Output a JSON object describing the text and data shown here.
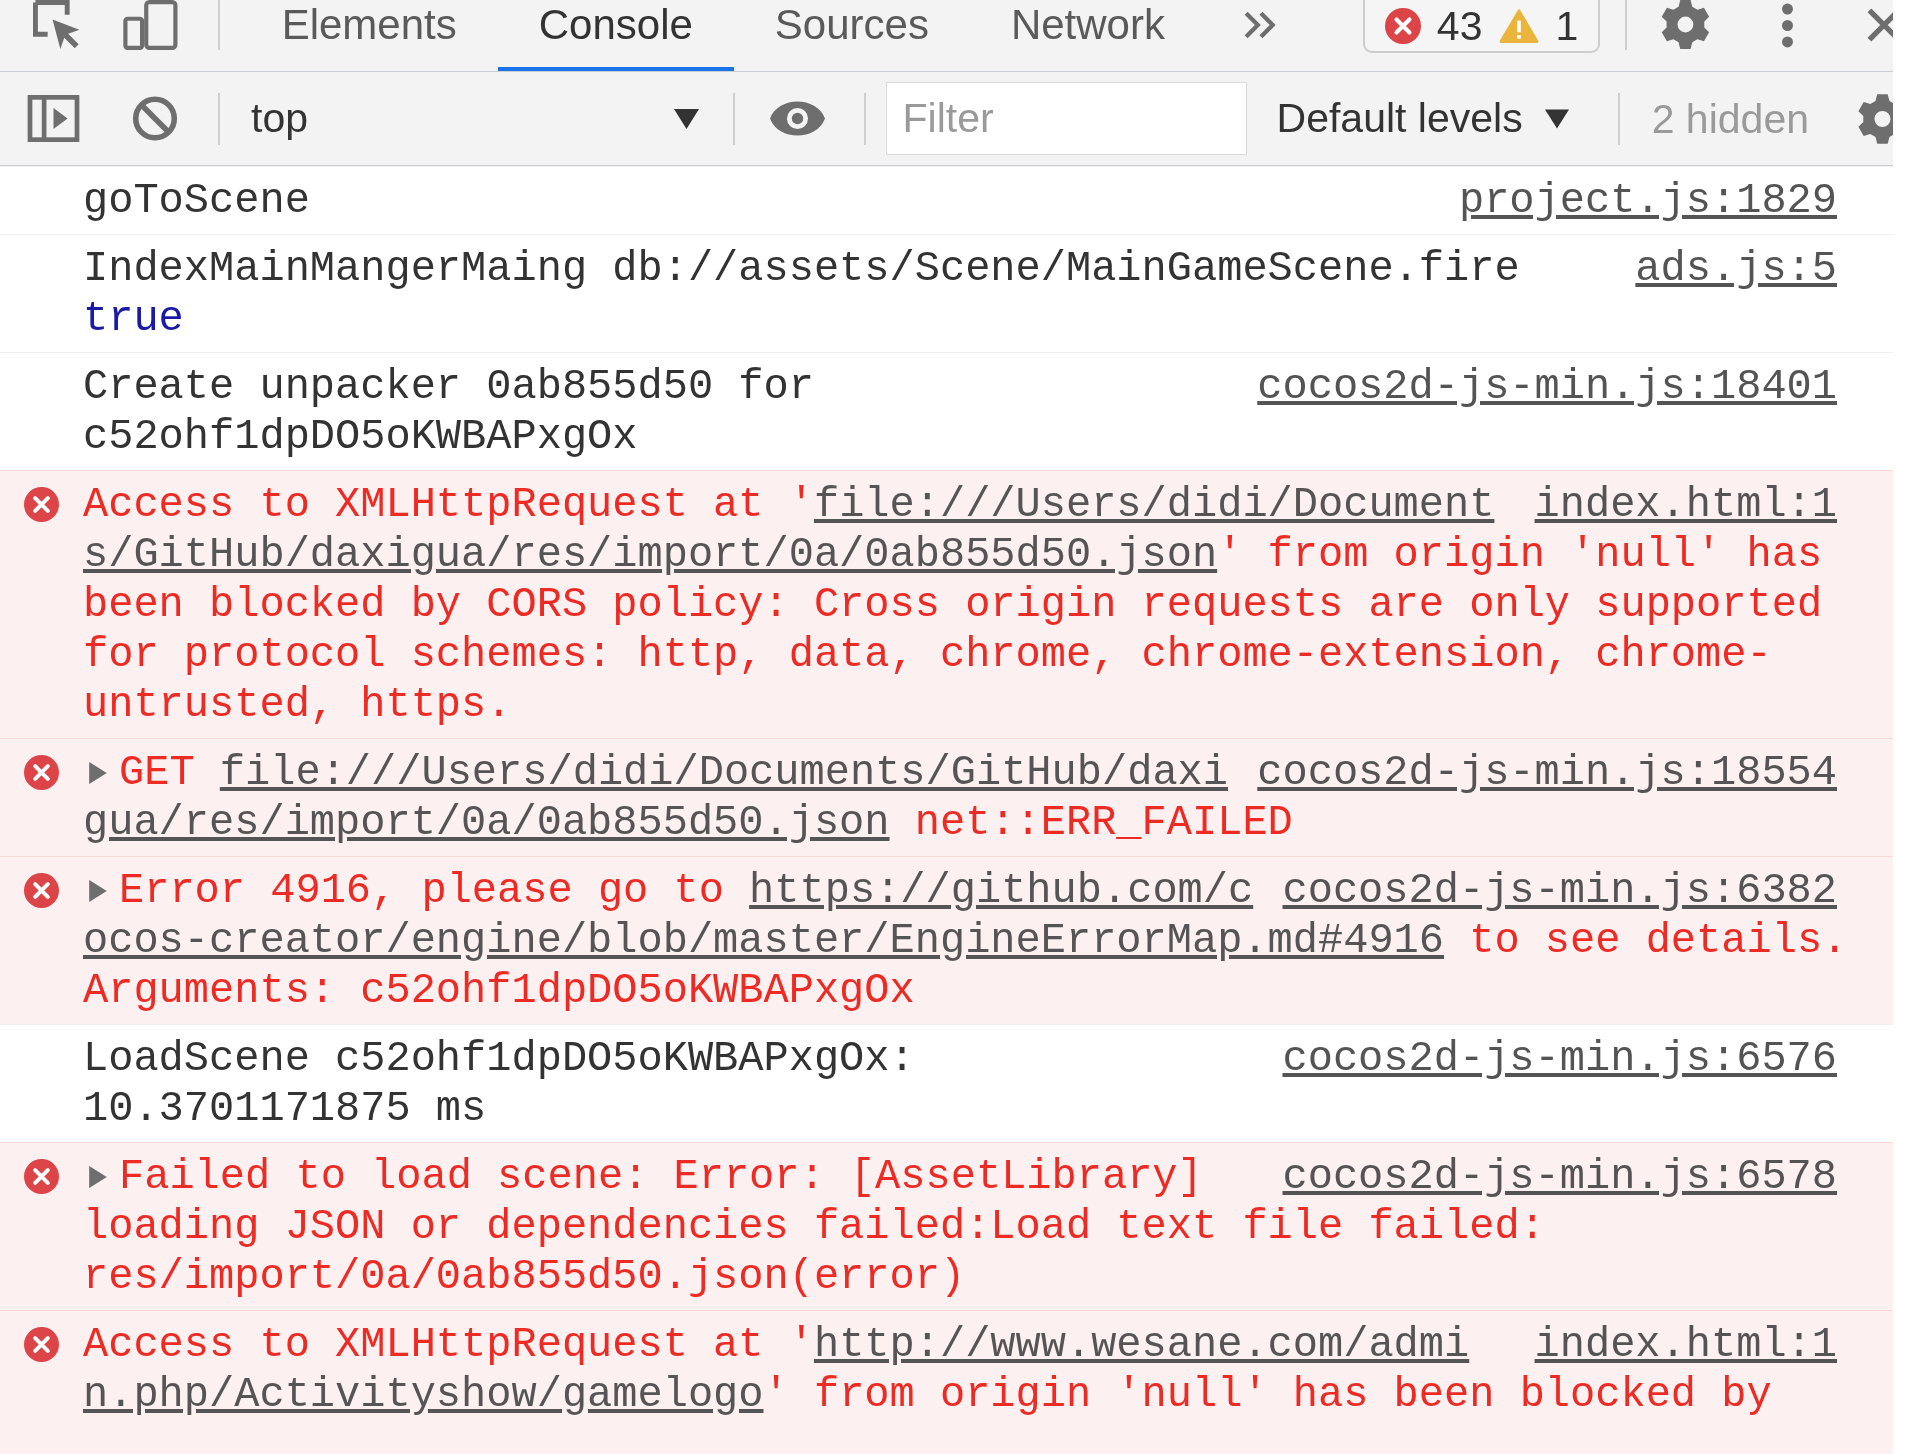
{
  "tabs": [
    {
      "label": "Elements",
      "selected": false
    },
    {
      "label": "Console",
      "selected": true
    },
    {
      "label": "Sources",
      "selected": false
    },
    {
      "label": "Network",
      "selected": false
    }
  ],
  "issues": {
    "errors": "43",
    "warnings": "1"
  },
  "console_toolbar": {
    "context": "top",
    "filter": {
      "placeholder": "Filter"
    },
    "levels": "Default levels",
    "hidden": "2 hidden"
  },
  "messages": [
    {
      "kind": "log",
      "segments": [
        {
          "kind": "text",
          "text": "goToScene"
        }
      ],
      "source": "project.js:1829"
    },
    {
      "kind": "log",
      "segments": [
        {
          "kind": "text",
          "text": "IndexMainMangerMaing db://assets/Scene/MainGameScene.fire "
        },
        {
          "kind": "boolean",
          "text": "true"
        }
      ],
      "source": "ads.js:5"
    },
    {
      "kind": "log",
      "segments": [
        {
          "kind": "text",
          "text": "Create unpacker 0ab855d50 for c52ohf1dpDO5oKWBAPxgOx"
        }
      ],
      "source": "cocos2d-js-min.js:18401"
    },
    {
      "kind": "error",
      "segments": [
        {
          "kind": "text",
          "text": "Access to XMLHttpRequest at '"
        },
        {
          "kind": "link",
          "text": "file:///Users/didi/Document"
        },
        {
          "kind": "link",
          "text": "s/GitHub/daxigua/res/import/0a/0ab855d50.json"
        },
        {
          "kind": "text",
          "text": "' from origin 'null' has been blocked by CORS policy: Cross origin requests are only supported for protocol schemes: http, data, chrome, chrome-extension, chrome-untrusted, https."
        }
      ],
      "source": "index.html:1"
    },
    {
      "kind": "error",
      "expanded": false,
      "segments": [
        {
          "kind": "text",
          "text": "GET "
        },
        {
          "kind": "link",
          "text": "file:///Users/didi/Documents/GitHub/daxi"
        },
        {
          "kind": "link",
          "text": "gua/res/import/0a/0ab855d50.json"
        },
        {
          "kind": "text",
          "text": " net::ERR_FAILED"
        }
      ],
      "source": "cocos2d-js-min.js:18554"
    },
    {
      "kind": "error",
      "expanded": false,
      "segments": [
        {
          "kind": "text",
          "text": "Error 4916, please go to "
        },
        {
          "kind": "link",
          "text": "https://github.com/c"
        },
        {
          "kind": "link",
          "text": "ocos-creator/engine/blob/master/EngineErrorMap.md#4916"
        },
        {
          "kind": "text",
          "text": " to see details. Arguments: c52ohf1dpDO5oKWBAPxgOx"
        }
      ],
      "source": "cocos2d-js-min.js:6382"
    },
    {
      "kind": "log",
      "segments": [
        {
          "kind": "text",
          "text": "LoadScene c52ohf1dpDO5oKWBAPxgOx: 10.3701171875 ms"
        }
      ],
      "source": "cocos2d-js-min.js:6576"
    },
    {
      "kind": "error",
      "expanded": false,
      "segments": [
        {
          "kind": "text",
          "text": "Failed to load scene: Error: [AssetLibrary] loading JSON or dependencies failed:Load text file failed: res/import/0a/0ab855d50.json(error)"
        }
      ],
      "source": "cocos2d-js-min.js:6578"
    },
    {
      "kind": "error",
      "segments": [
        {
          "kind": "text",
          "text": "Access to XMLHttpRequest at '"
        },
        {
          "kind": "link",
          "text": "http://www.wesane.com/admi"
        },
        {
          "kind": "link",
          "text": "n.php/Activityshow/gamelogo"
        },
        {
          "kind": "text",
          "text": "' from origin 'null' has been blocked by"
        }
      ],
      "source": "index.html:1"
    }
  ]
}
